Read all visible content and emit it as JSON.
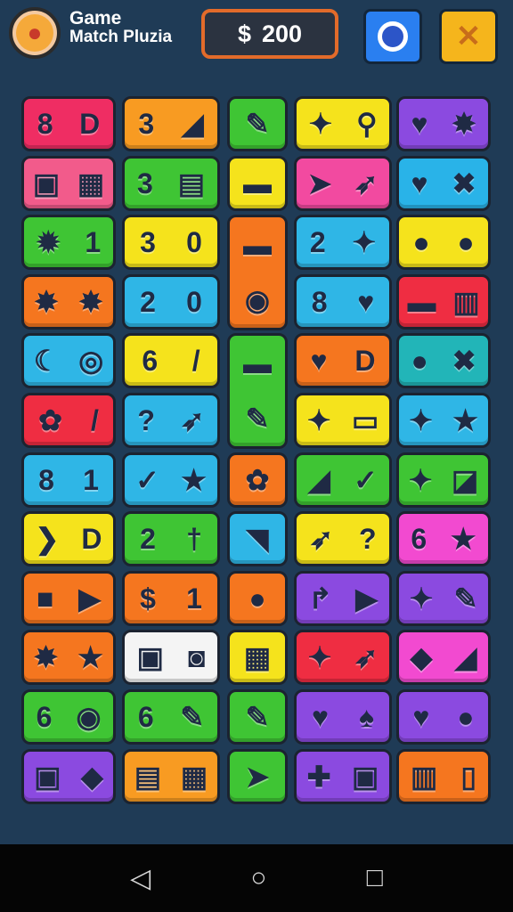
{
  "header": {
    "logo_icon": "pizza-icon",
    "title_line1": "Game",
    "title_line2": "Match Pluzia",
    "money_symbol": "$",
    "money_amount": "200",
    "settings_icon": "ring-icon",
    "close_icon": "x-icon"
  },
  "colors": {
    "background": "#1f3b56",
    "money_border": "#e36b2a",
    "btn_blue": "#2a7ff0",
    "btn_yellow": "#f5b51c"
  },
  "tiles": [
    {
      "a": "8",
      "b": "D",
      "color": "#ef2d63"
    },
    {
      "a": "3",
      "b": "◢",
      "color": "#f89b22"
    },
    {
      "a": "✎",
      "b": "",
      "color": "#3fc534"
    },
    {
      "a": "✦",
      "b": "⚲",
      "color": "#f5e31c"
    },
    {
      "a": "♥",
      "b": "✸",
      "color": "#8b4ae0"
    },
    {
      "a": "▣",
      "b": "▦",
      "color": "#f25b8b"
    },
    {
      "a": "3",
      "b": "▤",
      "color": "#3fc534"
    },
    {
      "a": "▬",
      "b": "",
      "color": "#f5e31c"
    },
    {
      "a": "➤",
      "b": "➶",
      "color": "#f24aa0"
    },
    {
      "a": "♥",
      "b": "✖",
      "color": "#29b3e8"
    },
    {
      "a": "✹",
      "b": "1",
      "color": "#3fc534"
    },
    {
      "a": "3",
      "b": "0",
      "color": "#f5e31c"
    },
    {
      "a": "▬",
      "b": "◉",
      "color": "#f5761f"
    },
    {
      "a": "2",
      "b": "✦",
      "color": "#2fb6e6"
    },
    {
      "a": "●",
      "b": "●",
      "color": "#f5e31c"
    },
    {
      "a": "✸",
      "b": "✸",
      "color": "#f5761f"
    },
    {
      "a": "2",
      "b": "0",
      "color": "#2fb6e6"
    },
    {
      "a": "8",
      "b": "♥",
      "color": "#2fb6e6"
    },
    {
      "a": "▬",
      "b": "▥",
      "color": "#ef2d42"
    },
    {
      "a": "☾",
      "b": "◎",
      "color": "#2fb6e6"
    },
    {
      "a": "6",
      "b": "/",
      "color": "#f5e31c"
    },
    {
      "a": "▬",
      "b": "✎",
      "color": "#3fc534"
    },
    {
      "a": "♥",
      "b": "D",
      "color": "#f5761f"
    },
    {
      "a": "●",
      "b": "✖",
      "color": "#22b5b8"
    },
    {
      "a": "✿",
      "b": "/",
      "color": "#ef2d42"
    },
    {
      "a": "?",
      "b": "➶",
      "color": "#2fb6e6"
    },
    {
      "a": "✦",
      "b": "▭",
      "color": "#f5e31c"
    },
    {
      "a": "✦",
      "b": "★",
      "color": "#2fb6e6"
    },
    {
      "a": "8",
      "b": "1",
      "color": "#2fb6e6"
    },
    {
      "a": "✓",
      "b": "★",
      "color": "#2fb6e6"
    },
    {
      "a": "✿",
      "b": "",
      "color": "#f5761f"
    },
    {
      "a": "◢",
      "b": "✓",
      "color": "#3fc534"
    },
    {
      "a": "✦",
      "b": "◪",
      "color": "#3fc534"
    },
    {
      "a": "❯",
      "b": "D",
      "color": "#f5e31c"
    },
    {
      "a": "2",
      "b": "†",
      "color": "#3fc534"
    },
    {
      "a": "◥",
      "b": "",
      "color": "#2fb6e6"
    },
    {
      "a": "➶",
      "b": "?",
      "color": "#f5e31c"
    },
    {
      "a": "6",
      "b": "★",
      "color": "#f24ad0"
    },
    {
      "a": "■",
      "b": "▶",
      "color": "#f5761f"
    },
    {
      "a": "$",
      "b": "1",
      "color": "#f5761f"
    },
    {
      "a": "●",
      "b": "",
      "color": "#f5761f"
    },
    {
      "a": "↱",
      "b": "▶",
      "color": "#8b4ae0"
    },
    {
      "a": "✦",
      "b": "✎",
      "color": "#8b4ae0"
    },
    {
      "a": "✸",
      "b": "★",
      "color": "#f5761f"
    },
    {
      "a": "▣",
      "b": "◙",
      "color": "#f4f4f4"
    },
    {
      "a": "▦",
      "b": "",
      "color": "#f5e31c"
    },
    {
      "a": "✦",
      "b": "➶",
      "color": "#ef2d42"
    },
    {
      "a": "◆",
      "b": "◢",
      "color": "#f24ad0"
    },
    {
      "a": "6",
      "b": "◉",
      "color": "#3fc534"
    },
    {
      "a": "6",
      "b": "✎",
      "color": "#3fc534"
    },
    {
      "a": "✎",
      "b": "",
      "color": "#3fc534"
    },
    {
      "a": "♥",
      "b": "♠",
      "color": "#8b4ae0"
    },
    {
      "a": "♥",
      "b": "●",
      "color": "#8b4ae0"
    },
    {
      "a": "▣",
      "b": "◆",
      "color": "#8b4ae0"
    },
    {
      "a": "▤",
      "b": "▦",
      "color": "#f89b22"
    },
    {
      "a": "➤",
      "b": "",
      "color": "#3fc534"
    },
    {
      "a": "✚",
      "b": "▣",
      "color": "#8b4ae0"
    },
    {
      "a": "▥",
      "b": "▯",
      "color": "#f5761f"
    }
  ],
  "navbar": {
    "back": "◁",
    "home": "○",
    "recent": "□"
  }
}
